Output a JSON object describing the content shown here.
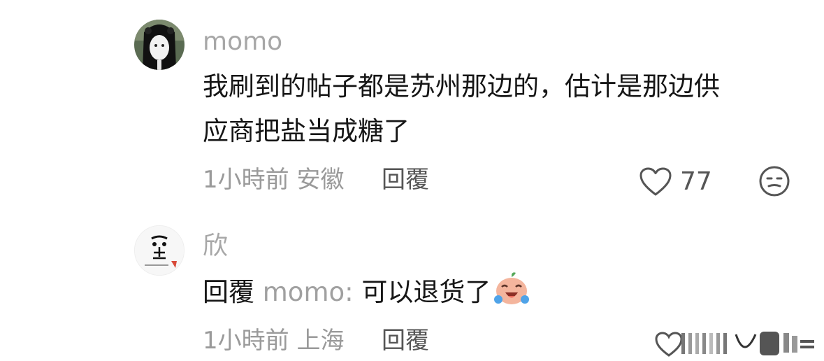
{
  "comments": [
    {
      "username": "momo",
      "text_line1": "我刷到的帖子都是苏州那边的，估计是那边供",
      "text_line2": "应商把盐当成糖了",
      "time_location": "1小時前 安徽",
      "reply_label": "回覆",
      "like_count": "77"
    },
    {
      "username": "欣",
      "reply_prefix": "回覆",
      "mention": "momo:",
      "text": " 可以退货了",
      "time_location": "1小時前 上海",
      "reply_label": "回覆"
    }
  ],
  "icons": {
    "like": "heart-outline-icon",
    "dislike": "neutral-face-icon",
    "emoji": "crying-laughing-face-emoji"
  }
}
